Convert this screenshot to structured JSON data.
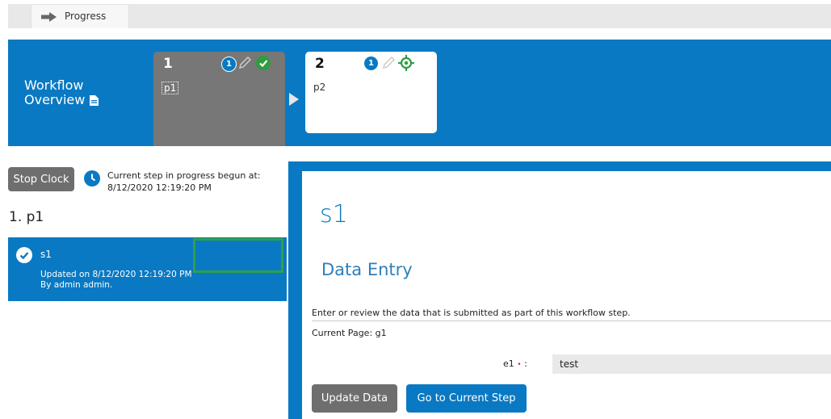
{
  "tabs": [
    {
      "label": "Progress",
      "icon": "arrow-right-icon"
    }
  ],
  "workflow_overview": {
    "title_line1": "Workflow",
    "title_line2": "Overview",
    "title_icon": "document-icon",
    "steps": [
      {
        "number": "1",
        "badge_count": "1",
        "name": "p1",
        "status": "complete",
        "status_icon": "check-circle-icon"
      },
      {
        "number": "2",
        "badge_count": "1",
        "name": "p2",
        "status": "current",
        "status_icon": "target-icon"
      }
    ]
  },
  "left_panel": {
    "stop_clock_label": "Stop Clock",
    "clock_text_line1": "Current step in progress begun at:",
    "clock_text_line2": "8/12/2020 12:19:20 PM",
    "page_heading": "1. p1",
    "steps": [
      {
        "name": "s1",
        "updated_line1": "Updated on 8/12/2020 12:19:20 PM",
        "updated_line2": "By admin admin."
      }
    ]
  },
  "main": {
    "step_title": "s1",
    "section_title": "Data Entry",
    "intro_text": "Enter or review the data that is submitted as part of this workflow step.",
    "current_page": "Current Page: g1",
    "fields": [
      {
        "label": "e1",
        "required_mark": "•",
        "value": "test"
      }
    ],
    "update_button": "Update Data",
    "goto_button": "Go to Current Step"
  },
  "colors": {
    "brand_blue": "#0a79c3",
    "gray_button": "#6e6e6e",
    "success_green": "#2e9c3f",
    "selection_green": "#2ea04a"
  }
}
